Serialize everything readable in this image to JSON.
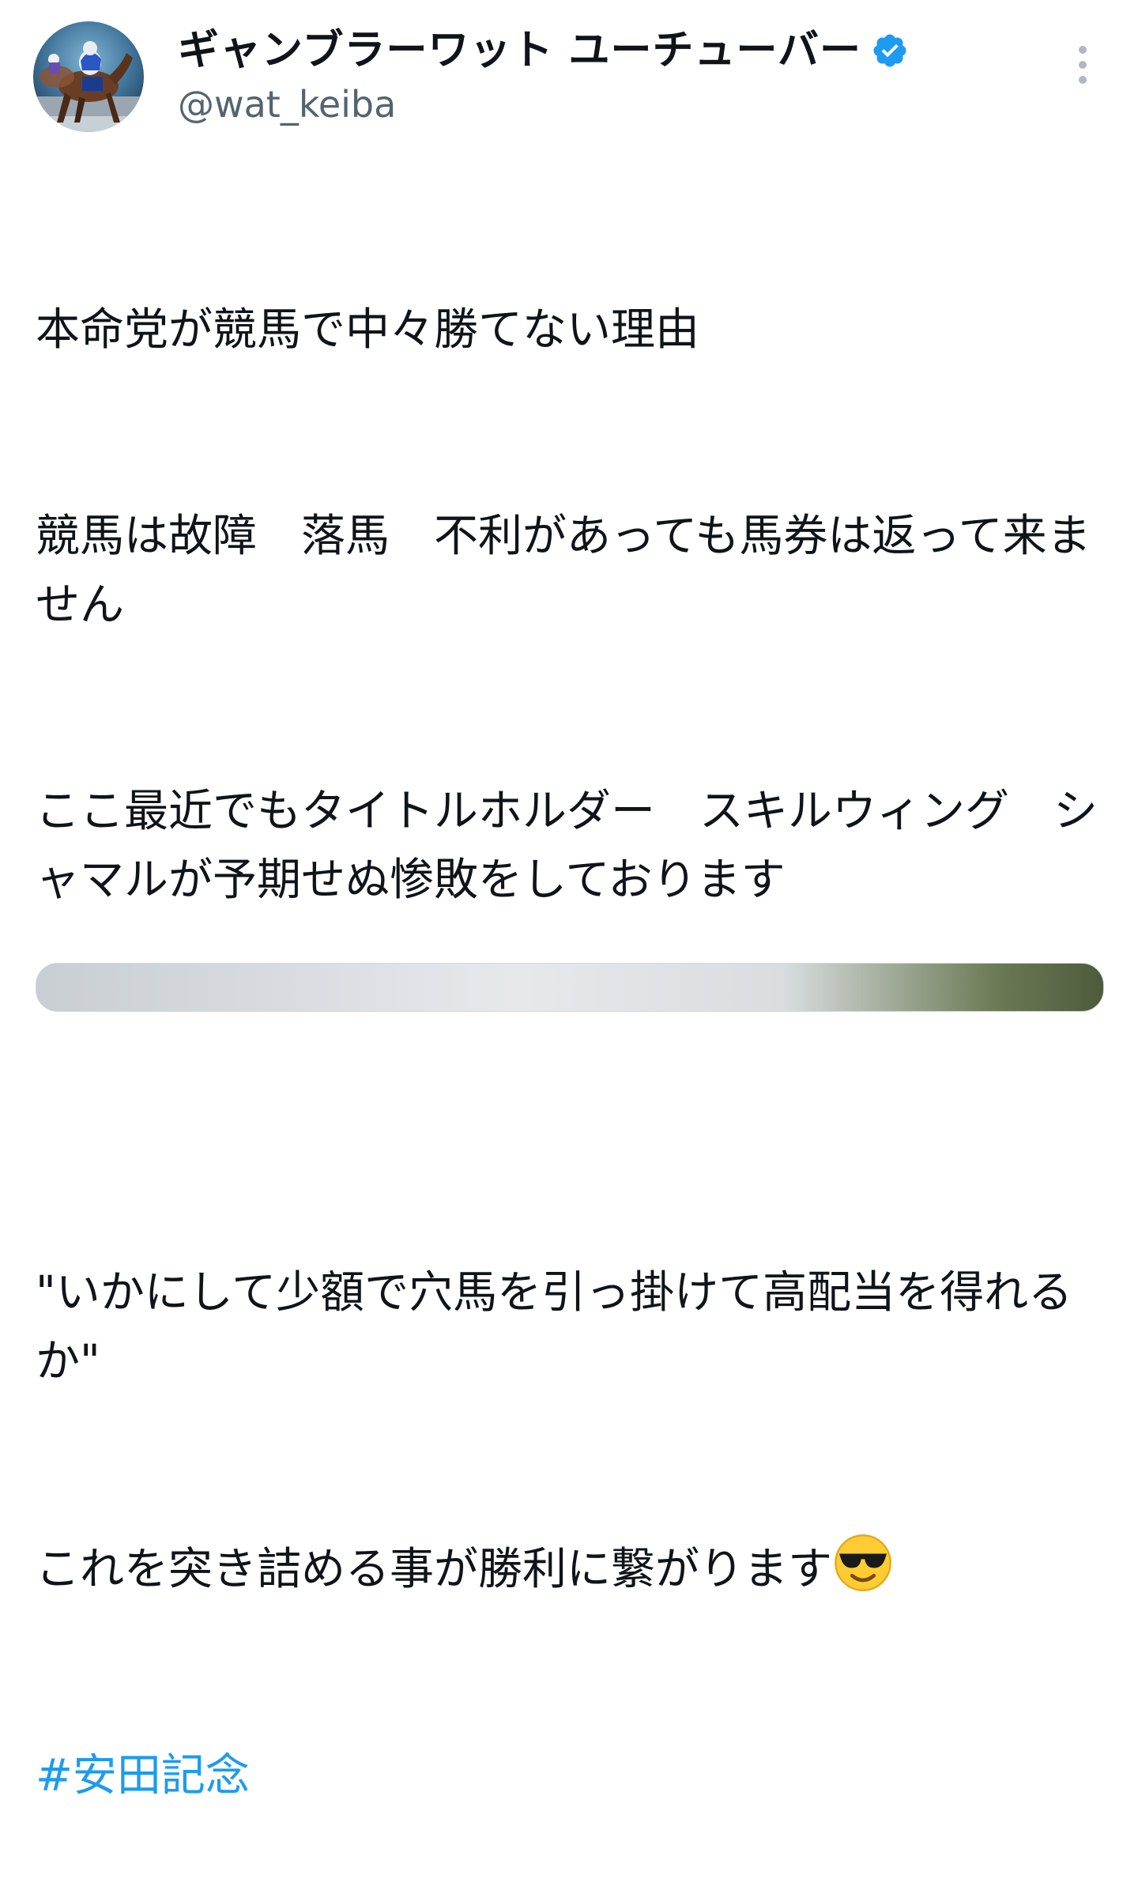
{
  "author": {
    "display_name": "ギャンブラーワット ユーチューバー",
    "handle": "@wat_keiba",
    "verified": true,
    "avatar_icon": "racehorse-photo-avatar"
  },
  "tweet": {
    "lines": [
      "本命党が競馬で中々勝てない理由",
      "競馬は故障　落馬　不利があっても馬券は返って来ません",
      "ここ最近でもタイトルホルダー　スキルウィング　シャマルが予期せぬ惨敗をしております",
      "",
      "\"いかにして少額で穴馬を引っ掛けて高配当を得れるか\"",
      "これを突き詰める事が勝利に繋がります"
    ],
    "emoji": "smiling-face-with-sunglasses",
    "hashtag": "#安田記念"
  },
  "colors": {
    "text": "#0f1419",
    "secondary": "#536471",
    "link": "#1d9bf0",
    "verified": "#1d9bf0"
  },
  "icons": {
    "more": "more-vertical-icon",
    "verified": "verified-badge-icon"
  }
}
